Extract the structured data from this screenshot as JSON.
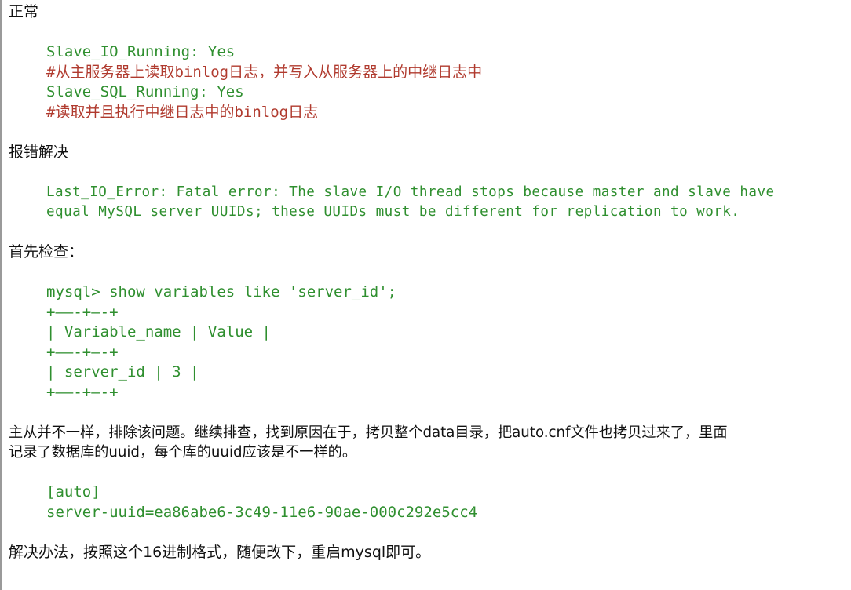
{
  "sections": {
    "normal_heading": "正常",
    "io_running": "Slave_IO_Running: Yes",
    "io_comment": "#从主服务器上读取binlog日志，并写入从服务器上的中继日志中",
    "sql_running": "Slave_SQL_Running: Yes",
    "sql_comment": "#读取并且执行中继日志中的binlog日志",
    "error_heading": "报错解决",
    "error_line1": "Last_IO_Error: Fatal error: The slave I/O thread stops because master and slave have",
    "error_line2": "equal MySQL server UUIDs; these UUIDs must be different for replication to work.",
    "check_heading": "首先检查：",
    "sql_command": "mysql> show variables like 'server_id';",
    "table_border": "+——-+—-+",
    "table_header": "| Variable_name | Value |",
    "table_row": "| server_id | 3 |",
    "explain_line1": "主从并不一样，排除该问题。继续排查，找到原因在于，拷贝整个data目录，把auto.cnf文件也拷贝过来了，里面",
    "explain_line2": "记录了数据库的uuid，每个库的uuid应该是不一样的。",
    "auto_section": "[auto]",
    "server_uuid": "server-uuid=ea86abe6-3c49-11e6-90ae-000c292e5cc4",
    "solution": "解决办法，按照这个16进制格式，随便改下，重启mysql即可。"
  },
  "colors": {
    "code_green": "#2f8f2f",
    "comment_red": "#b03a2e",
    "text": "#111111",
    "border": "#9a9a9a"
  }
}
